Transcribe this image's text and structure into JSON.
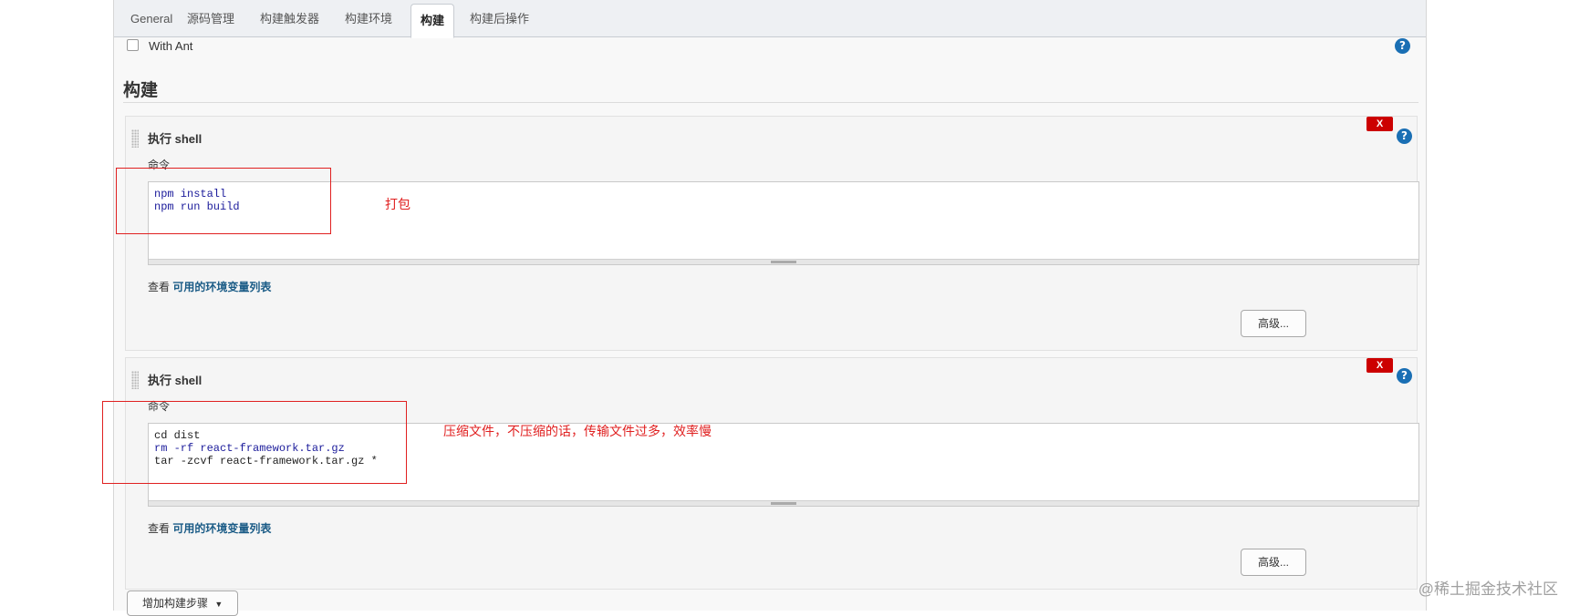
{
  "tabs": [
    {
      "label": "General",
      "active": false
    },
    {
      "label": "源码管理",
      "active": false
    },
    {
      "label": "构建触发器",
      "active": false
    },
    {
      "label": "构建环境",
      "active": false
    },
    {
      "label": "构建",
      "active": true
    },
    {
      "label": "构建后操作",
      "active": false
    }
  ],
  "with_ant": {
    "label": "With Ant",
    "checked": false
  },
  "help_icon_glyph": "?",
  "section": {
    "title": "构建"
  },
  "steps": [
    {
      "title": "执行 shell",
      "delete_label": "X",
      "command_label": "命令",
      "command_lines": [
        "npm install",
        "npm run build"
      ],
      "env_prefix": "查看",
      "env_link": "可用的环境变量列表",
      "advanced_label": "高级...",
      "annotation": "打包"
    },
    {
      "title": "执行 shell",
      "delete_label": "X",
      "command_label": "命令",
      "command_lines": [
        "cd dist",
        "rm -rf react-framework.tar.gz",
        "tar -zcvf react-framework.tar.gz *"
      ],
      "env_prefix": "查看",
      "env_link": "可用的环境变量列表",
      "advanced_label": "高级...",
      "annotation": "压缩文件，不压缩的话，传输文件过多，效率慢"
    }
  ],
  "add_step": {
    "label": "增加构建步骤"
  },
  "watermark": "@稀土掘金技术社区",
  "colors": {
    "annotation": "#e02020",
    "delete": "#cc0000",
    "help": "#1a6fb4",
    "link": "#1a5b86"
  }
}
